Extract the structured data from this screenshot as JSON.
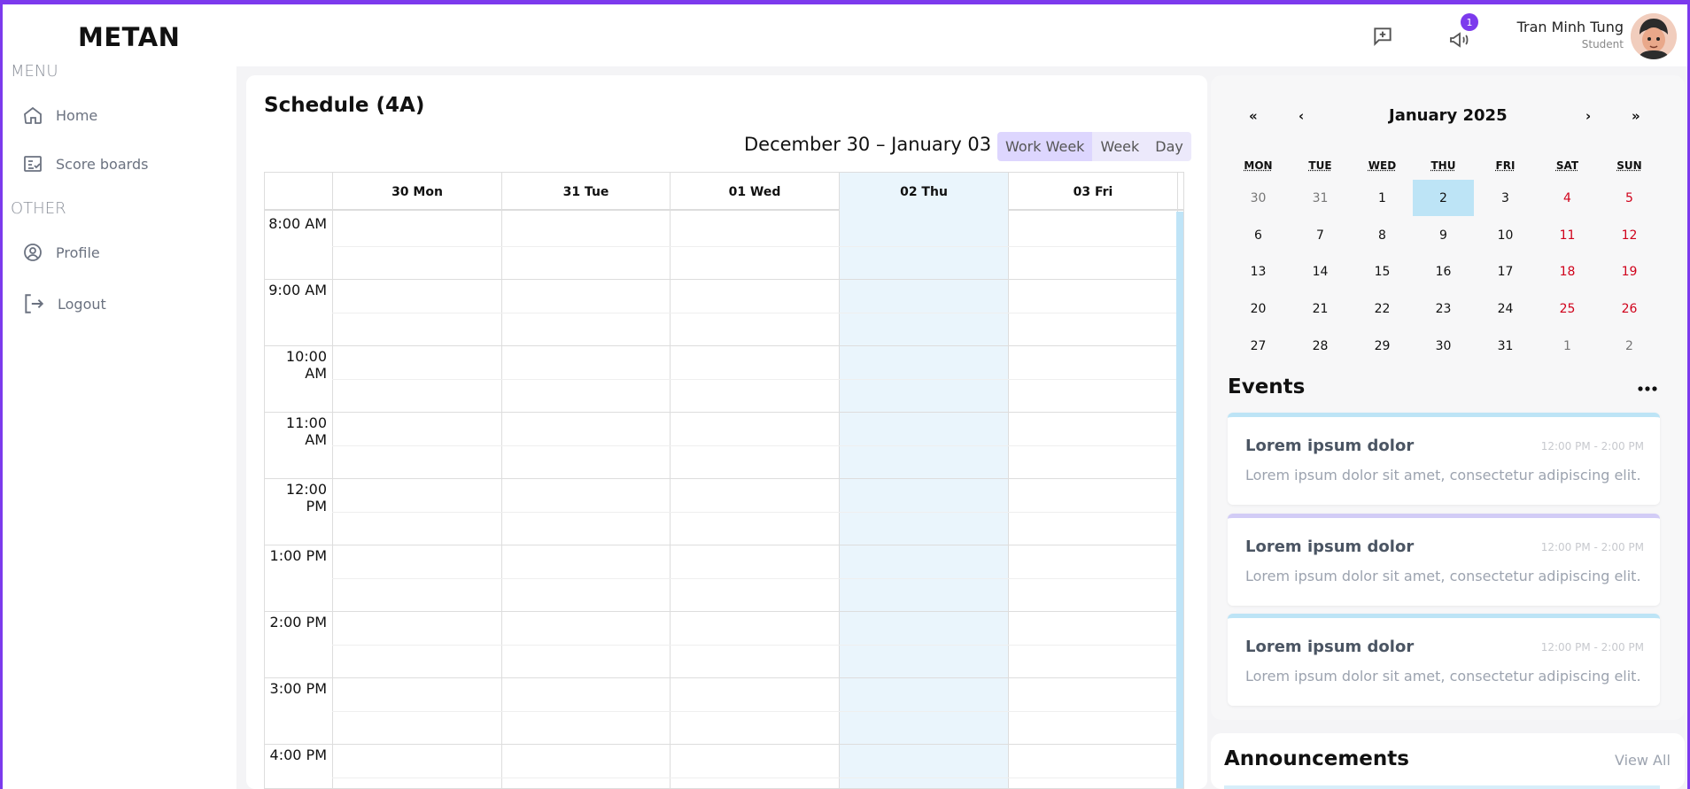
{
  "app": {
    "logo": "METAN"
  },
  "sidebar": {
    "menu_label": "MENU",
    "other_label": "OTHER",
    "menu_items": [
      {
        "label": "Home",
        "icon": "home-icon"
      },
      {
        "label": "Score boards",
        "icon": "scoreboard-icon"
      }
    ],
    "other_items": [
      {
        "label": "Profile",
        "icon": "profile-icon"
      },
      {
        "label": "Logout",
        "icon": "logout-icon"
      }
    ]
  },
  "topbar": {
    "message_icon": "add-message-icon",
    "announce_icon": "megaphone-icon",
    "announce_badge": "1",
    "user": {
      "name": "Tran Minh Tung",
      "role": "Student"
    }
  },
  "schedule": {
    "title": "Schedule (4A)",
    "range": "December 30 – January 03",
    "views": [
      "Work Week",
      "Week",
      "Day"
    ],
    "active_view": "Work Week",
    "days": [
      "30 Mon",
      "31 Tue",
      "01 Wed",
      "02 Thu",
      "03 Fri"
    ],
    "today_index": 3,
    "times": [
      "8:00 AM",
      "9:00 AM",
      "10:00 AM",
      "11:00 AM",
      "12:00 PM",
      "1:00 PM",
      "2:00 PM",
      "3:00 PM",
      "4:00 PM"
    ]
  },
  "calendar": {
    "title": "January 2025",
    "nav": {
      "prev_year": "«",
      "prev_month": "‹",
      "next_month": "›",
      "next_year": "»"
    },
    "dow": [
      "MON",
      "TUE",
      "WED",
      "THU",
      "FRI",
      "SAT",
      "SUN"
    ],
    "weeks": [
      [
        "30",
        "31",
        "1",
        "2",
        "3",
        "4",
        "5"
      ],
      [
        "6",
        "7",
        "8",
        "9",
        "10",
        "11",
        "12"
      ],
      [
        "13",
        "14",
        "15",
        "16",
        "17",
        "18",
        "19"
      ],
      [
        "20",
        "21",
        "22",
        "23",
        "24",
        "25",
        "26"
      ],
      [
        "27",
        "28",
        "29",
        "30",
        "31",
        "1",
        "2"
      ]
    ],
    "today": "2"
  },
  "events": {
    "title": "Events",
    "items": [
      {
        "title": "Lorem ipsum dolor",
        "time": "12:00 PM - 2:00 PM",
        "desc": "Lorem ipsum dolor sit amet, consectetur adipiscing elit.",
        "accent": "#bde4f6"
      },
      {
        "title": "Lorem ipsum dolor",
        "time": "12:00 PM - 2:00 PM",
        "desc": "Lorem ipsum dolor sit amet, consectetur adipiscing elit.",
        "accent": "#d2ccf6"
      },
      {
        "title": "Lorem ipsum dolor",
        "time": "12:00 PM - 2:00 PM",
        "desc": "Lorem ipsum dolor sit amet, consectetur adipiscing elit.",
        "accent": "#bde4f6"
      }
    ]
  },
  "announcements": {
    "title": "Announcements",
    "view_all": "View All"
  },
  "colors": {
    "accent": "#7c3aed",
    "today": "#bde4f6",
    "weekend": "#d0021b"
  }
}
